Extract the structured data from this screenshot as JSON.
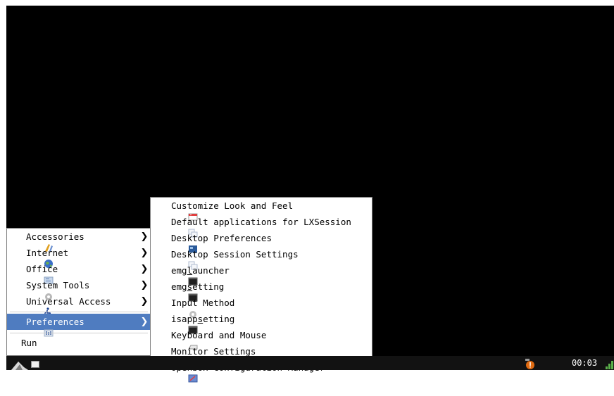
{
  "main_menu": {
    "items": [
      {
        "label": "Accessories",
        "icon": "accessories-icon"
      },
      {
        "label": "Internet",
        "icon": "internet-globe-icon"
      },
      {
        "label": "Office",
        "icon": "office-icon"
      },
      {
        "label": "System Tools",
        "icon": "system-tools-gear-icon"
      },
      {
        "label": "Universal Access",
        "icon": "universal-access-icon"
      },
      {
        "label": "Preferences",
        "icon": "preferences-icon"
      },
      {
        "label": "Run"
      }
    ],
    "submenu_arrow": "❯"
  },
  "preferences_submenu": {
    "items": [
      {
        "label": "Customize Look and Feel"
      },
      {
        "label": "Default applications for LXSession"
      },
      {
        "label": "Desktop Preferences"
      },
      {
        "label": "Desktop Session Settings"
      },
      {
        "pre": "emg",
        "mnemonic": "l",
        "post": "auncher"
      },
      {
        "pre": "emg",
        "mnemonic": "s",
        "post": "etting"
      },
      {
        "label": "Input Method"
      },
      {
        "pre": "isapp",
        "mnemonic": "s",
        "post": "etting"
      },
      {
        "label": "Keyboard and Mouse"
      },
      {
        "label": "Monitor Settings"
      },
      {
        "label": "Openbox Configuration Manager"
      }
    ]
  },
  "taskbar": {
    "clock": "00:03"
  },
  "colors": {
    "desktop": "#000000",
    "selection": "#4f7cc0",
    "menu_bg": "#ffffff",
    "taskbar": "#121212"
  }
}
